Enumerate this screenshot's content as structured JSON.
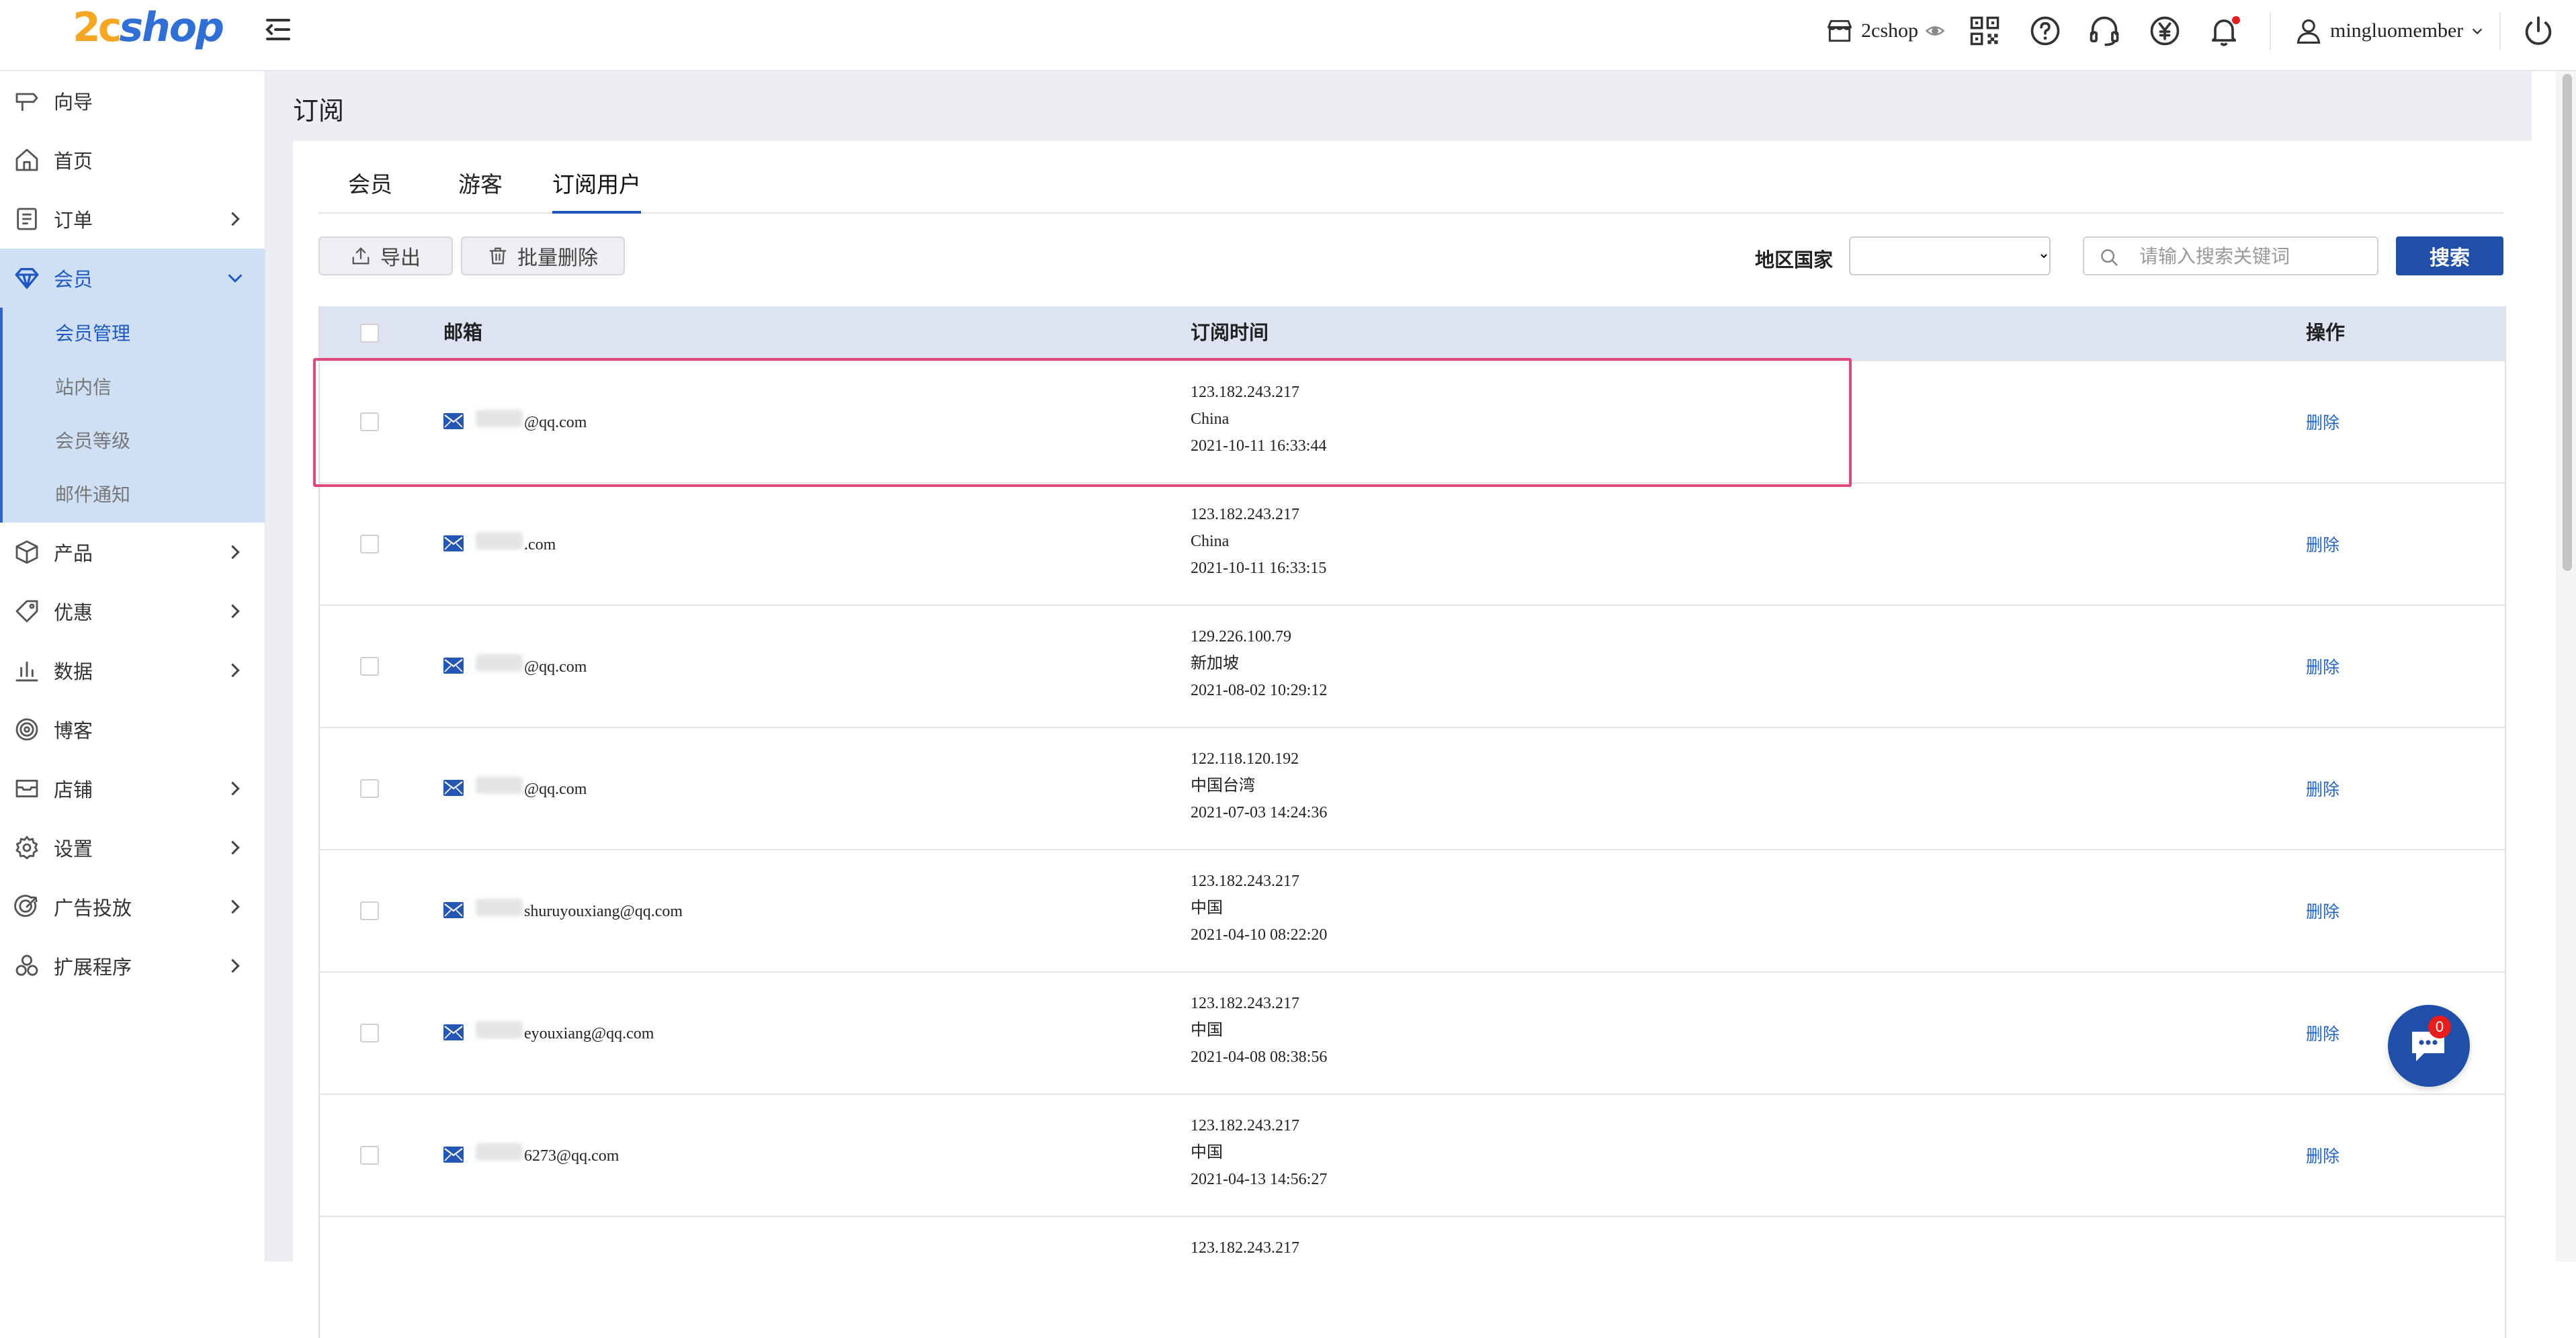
{
  "brand": {
    "logo_number": "2c",
    "logo_text": "shop"
  },
  "header": {
    "shop_name": "2cshop",
    "username": "mingluomember",
    "notification_dot_color": "#e02020",
    "icons": [
      "store-icon",
      "eye-icon",
      "qr-code-icon",
      "help-icon",
      "headset-icon",
      "currency-yen-icon",
      "bell-icon",
      "user-icon",
      "power-icon"
    ]
  },
  "sidebar": {
    "items": [
      {
        "label": "向导",
        "icon": "signpost-icon",
        "expandable": false
      },
      {
        "label": "首页",
        "icon": "home-icon",
        "expandable": false
      },
      {
        "label": "订单",
        "icon": "clipboard-icon",
        "expandable": true
      },
      {
        "label": "会员",
        "icon": "diamond-icon",
        "expandable": true,
        "expanded": true
      },
      {
        "label": "产品",
        "icon": "box-icon",
        "expandable": true
      },
      {
        "label": "优惠",
        "icon": "tag-icon",
        "expandable": true
      },
      {
        "label": "数据",
        "icon": "bar-chart-icon",
        "expandable": true
      },
      {
        "label": "博客",
        "icon": "target-icon",
        "expandable": false
      },
      {
        "label": "店铺",
        "icon": "storefront-icon",
        "expandable": true
      },
      {
        "label": "设置",
        "icon": "gear-icon",
        "expandable": true
      },
      {
        "label": "广告投放",
        "icon": "crosshair-icon",
        "expandable": true
      },
      {
        "label": "扩展程序",
        "icon": "apps-icon",
        "expandable": true
      }
    ],
    "submenu": [
      {
        "label": "会员管理",
        "current": true
      },
      {
        "label": "站内信",
        "current": false
      },
      {
        "label": "会员等级",
        "current": false
      },
      {
        "label": "邮件通知",
        "current": false
      }
    ]
  },
  "page": {
    "title": "订阅",
    "tabs": [
      {
        "label": "会员",
        "active": false
      },
      {
        "label": "游客",
        "active": false
      },
      {
        "label": "订阅用户",
        "active": true
      }
    ],
    "toolbar": {
      "export_label": "导出",
      "bulk_delete_label": "批量删除",
      "region_label": "地区国家",
      "region_value": "",
      "search_placeholder": "请输入搜索关键词",
      "search_button": "搜索"
    }
  },
  "table": {
    "columns": {
      "email": "邮箱",
      "time": "订阅时间",
      "action": "操作"
    },
    "rows": [
      {
        "email": "@qq.com",
        "ip": "123.182.243.217",
        "region": "China",
        "time": "2021-10-11 16:33:44",
        "action": "删除"
      },
      {
        "email": ".com",
        "ip": "123.182.243.217",
        "region": "China",
        "time": "2021-10-11 16:33:15",
        "action": "删除"
      },
      {
        "email": "@qq.com",
        "ip": "129.226.100.79",
        "region": "新加坡",
        "time": "2021-08-02 10:29:12",
        "action": "删除"
      },
      {
        "email": "@qq.com",
        "ip": "122.118.120.192",
        "region": "中国台湾",
        "time": "2021-07-03 14:24:36",
        "action": "删除"
      },
      {
        "email": "shuruyouxiang@qq.com",
        "ip": "123.182.243.217",
        "region": "中国",
        "time": "2021-04-10 08:22:20",
        "action": "删除"
      },
      {
        "email": "eyouxiang@qq.com",
        "ip": "123.182.243.217",
        "region": "中国",
        "time": "2021-04-08 08:38:56",
        "action": "删除"
      },
      {
        "email": "6273@qq.com",
        "ip": "123.182.243.217",
        "region": "中国",
        "time": "2021-04-13 14:56:27",
        "action": "删除"
      },
      {
        "email": "",
        "ip": "123.182.243.217",
        "region": "",
        "time": "",
        "action": ""
      }
    ]
  },
  "chat": {
    "badge_count": "0"
  },
  "colors": {
    "primary": "#1f4fa8",
    "link": "#2163c7",
    "sidebar_active_bg": "#cfe0f5",
    "highlight_border": "#e0497f",
    "logo_orange": "#f5a623",
    "logo_blue": "#2f6fd6"
  }
}
